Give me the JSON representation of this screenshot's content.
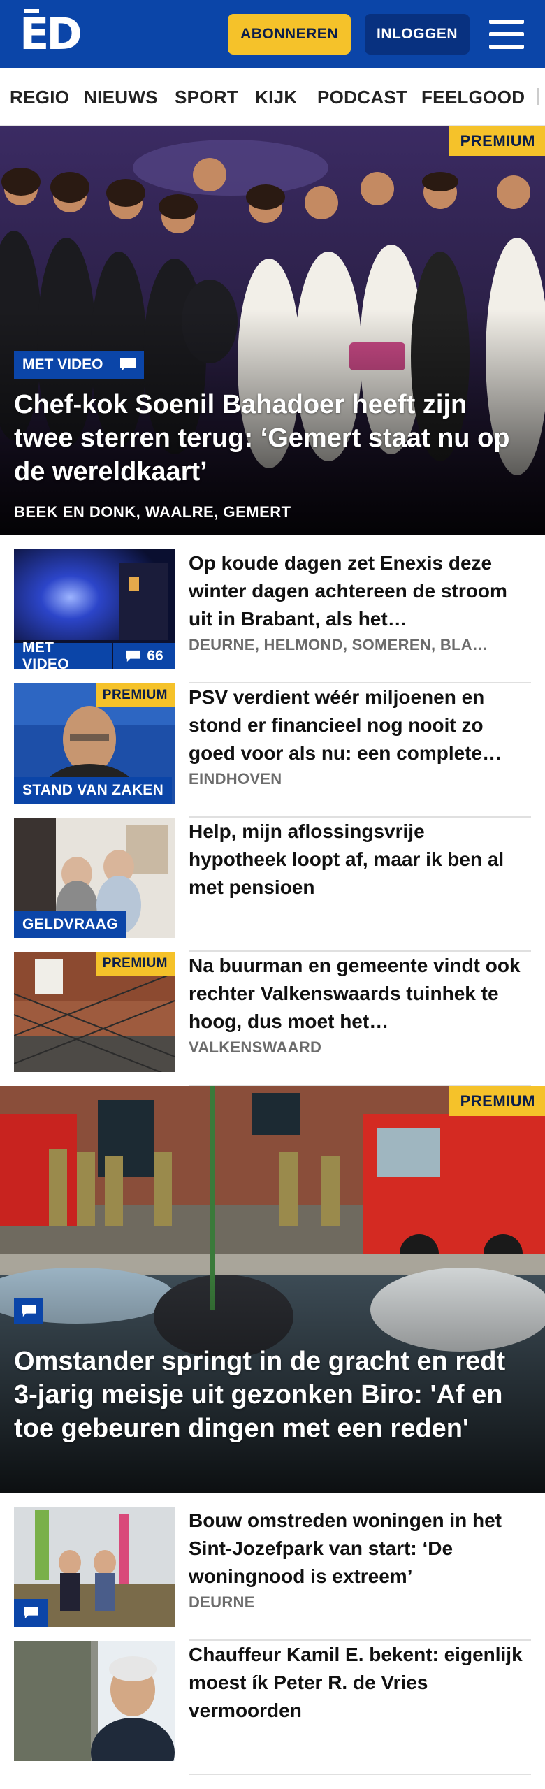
{
  "header": {
    "logo_text": "ED",
    "subscribe_label": "ABONNEREN",
    "login_label": "INLOGGEN",
    "menu_icon": "hamburger-menu-icon",
    "brand_color": "#0b45a8",
    "accent_color": "#f5c22a"
  },
  "nav": {
    "items": [
      "REGIO",
      "NIEUWS",
      "SPORT",
      "KIJK",
      "PODCAST",
      "FEELGOOD"
    ]
  },
  "hero1": {
    "premium": "PREMIUM",
    "video_label": "MET VIDEO",
    "title": "Chef-kok Soenil Bahadoer heeft zijn twee sterren terug: ‘Gemert staat nu op de wereldkaart’",
    "places": "BEEK EN DONK, WAALRE, GEMERT"
  },
  "list1": [
    {
      "title": "Op koude dagen zet Enexis deze winter dagen achtereen de stroom uit in Brabant, als het…",
      "place": "DEURNE, HELMOND, SOMEREN, BLA…",
      "label": "MET VIDEO",
      "comments": "66"
    },
    {
      "title": "PSV verdient wéér miljoenen en stond er financieel nog nooit zo goed voor als nu: een complete…",
      "place": "EINDHOVEN",
      "label": "STAND VAN ZAKEN",
      "premium": "PREMIUM"
    },
    {
      "title": "Help, mijn aflossingsvrije hypotheek loopt af, maar ik ben al met pensioen",
      "place": "",
      "label": "GELDVRAAG"
    },
    {
      "title": "Na buurman en gemeente vindt ook rechter Valkenswaards tuinhek te hoog, dus moet het…",
      "place": "VALKENSWAARD",
      "premium": "PREMIUM"
    }
  ],
  "hero2": {
    "premium": "PREMIUM",
    "title": "Omstander springt in de gracht en redt 3-jarig meisje uit gezonken Biro: 'Af en toe gebeuren dingen met een reden'"
  },
  "list2": [
    {
      "title": "Bouw omstreden woningen in het Sint-Jozefpark van start: ‘De woningnood is extreem’",
      "place": "DEURNE"
    },
    {
      "title": "Chauffeur Kamil E. bekent: eigenlijk moest ík Peter R. de Vries vermoorden",
      "place": ""
    }
  ]
}
